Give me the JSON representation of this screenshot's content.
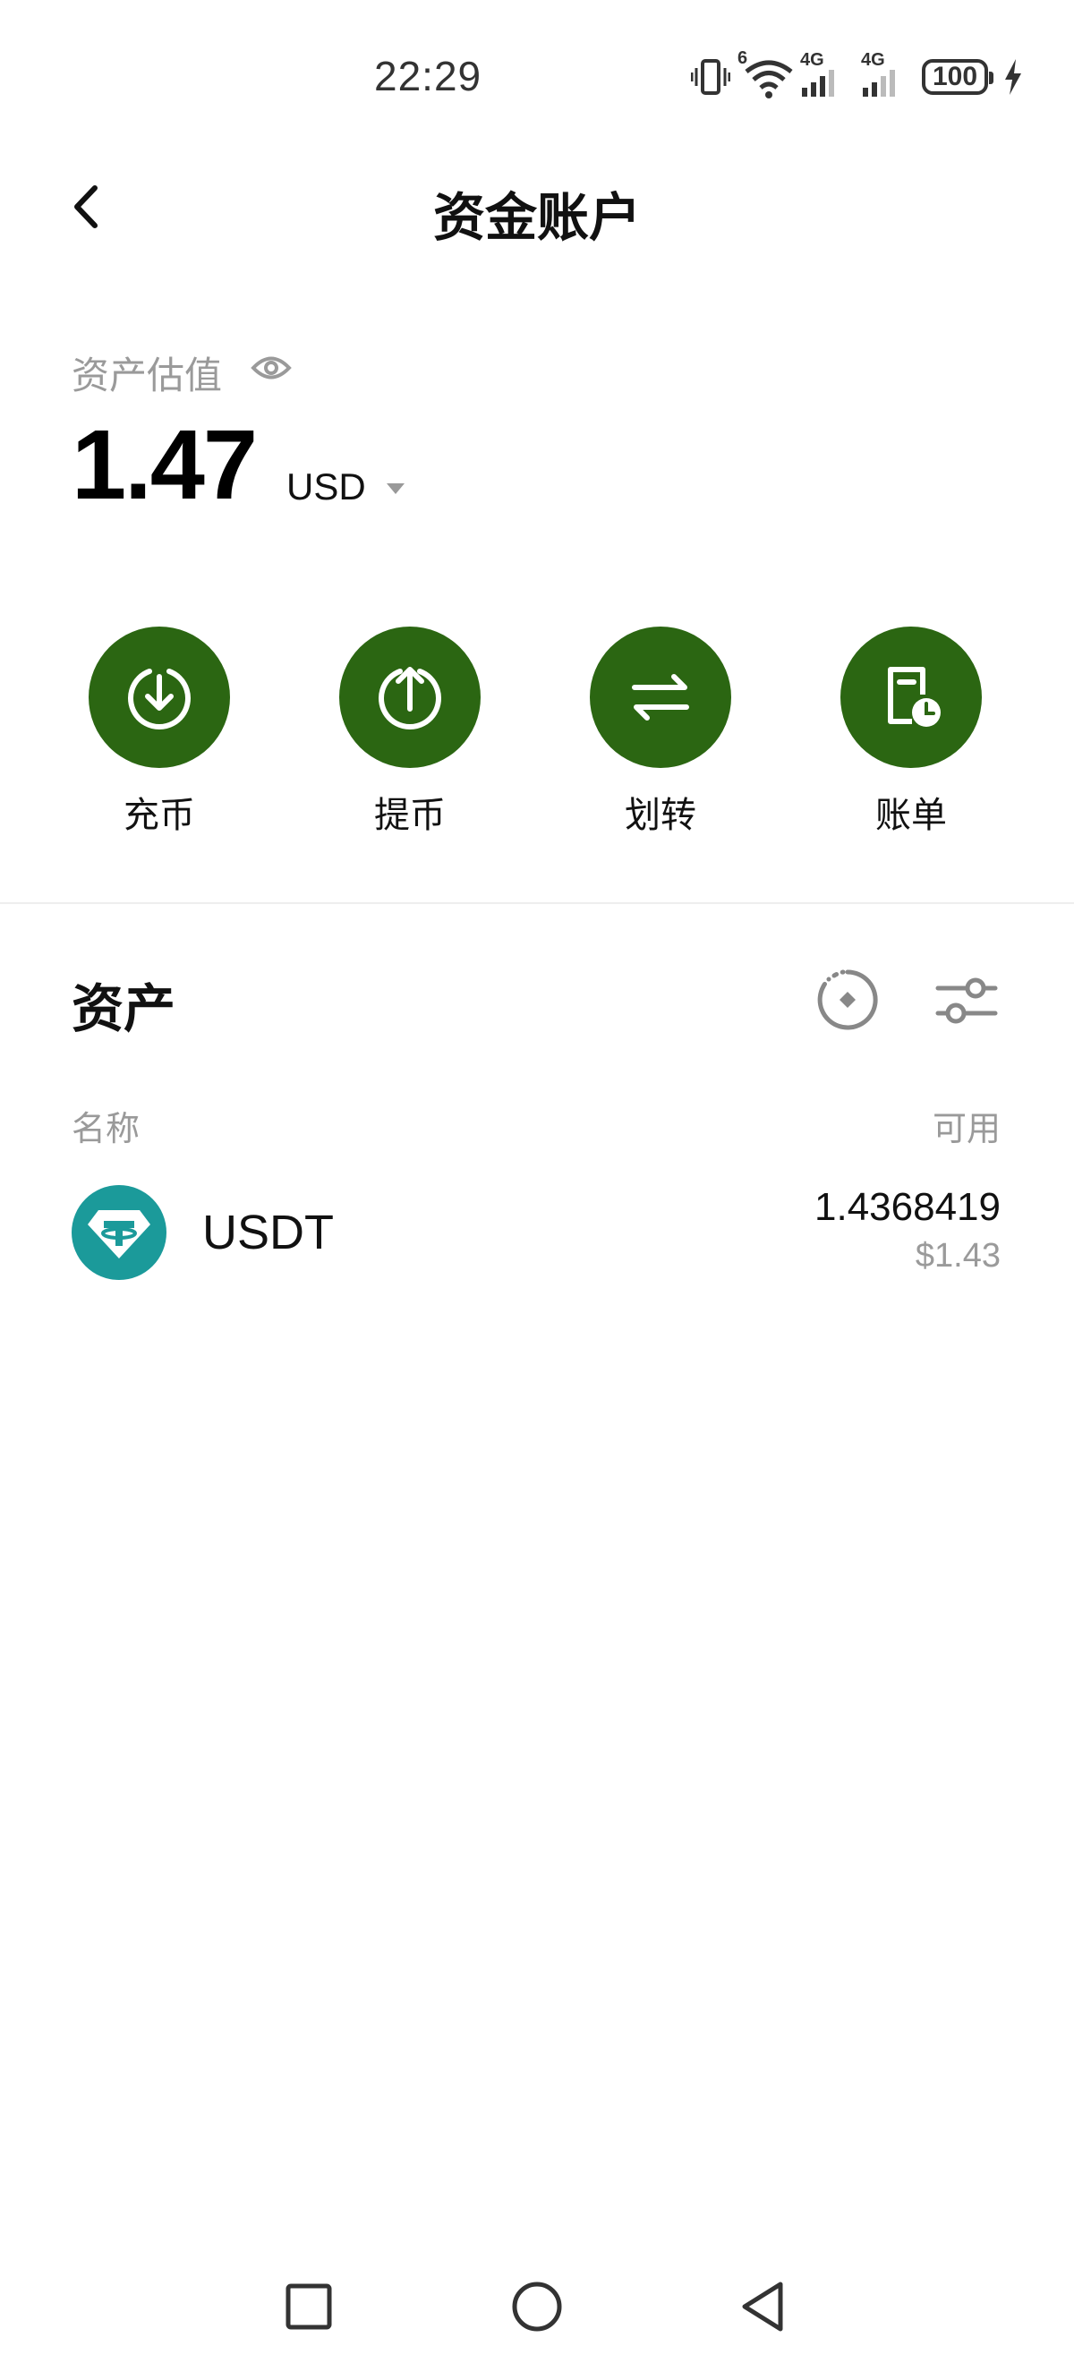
{
  "status_bar": {
    "time": "22:29",
    "battery": "100",
    "network_1": "4G",
    "network_2": "4G",
    "wifi_badge": "6"
  },
  "header": {
    "title": "资金账户"
  },
  "valuation": {
    "label": "资产估值",
    "amount": "1.47",
    "currency": "USD"
  },
  "actions": [
    {
      "label": "充币",
      "icon": "deposit-icon"
    },
    {
      "label": "提币",
      "icon": "withdraw-icon"
    },
    {
      "label": "划转",
      "icon": "transfer-icon"
    },
    {
      "label": "账单",
      "icon": "bill-icon"
    }
  ],
  "assets": {
    "title": "资产",
    "columns": {
      "name": "名称",
      "available": "可用"
    },
    "rows": [
      {
        "symbol": "USDT",
        "amount": "1.4368419",
        "usd_value": "$1.43"
      }
    ]
  },
  "colors": {
    "accent": "#2b6612",
    "tether": "#26a17b",
    "muted_text": "#9a9a9a"
  }
}
